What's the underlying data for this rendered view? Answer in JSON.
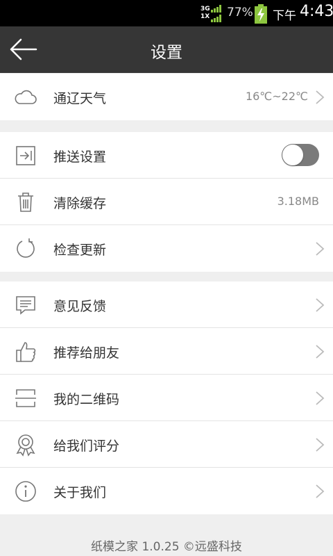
{
  "status_bar": {
    "network_top": "3G",
    "network_bottom": "1X",
    "battery_percent": "77%",
    "time_prefix": "下午",
    "time": "4:43"
  },
  "header": {
    "title": "设置",
    "back_icon": "arrow-left-icon"
  },
  "weather": {
    "label": "通辽天气",
    "value": "16℃~22℃",
    "icon": "cloud-icon"
  },
  "settings_group": {
    "push": {
      "label": "推送设置",
      "icon": "push-icon",
      "enabled": false
    },
    "cache": {
      "label": "清除缓存",
      "value": "3.18MB",
      "icon": "trash-icon"
    },
    "update": {
      "label": "检查更新",
      "icon": "refresh-icon"
    }
  },
  "more_group": {
    "feedback": {
      "label": "意见反馈",
      "icon": "comment-icon"
    },
    "share": {
      "label": "推荐给朋友",
      "icon": "thumbs-up-icon"
    },
    "qrcode": {
      "label": "我的二维码",
      "icon": "qr-code-icon"
    },
    "rate": {
      "label": "给我们评分",
      "icon": "award-icon"
    },
    "about": {
      "label": "关于我们",
      "icon": "info-icon"
    }
  },
  "footer": {
    "text": "纸模之家 1.0.25 ©远盛科技"
  },
  "colors": {
    "app_bar": "#363636",
    "background": "#efefef",
    "toggle_off": "#7a7a7a",
    "battery": "#8dc63f"
  }
}
